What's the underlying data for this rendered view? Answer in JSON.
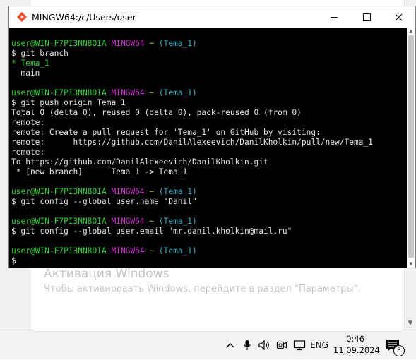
{
  "window": {
    "title": "MINGW64:/c/Users/user"
  },
  "terminal": {
    "prompt": {
      "user_host": "user@WIN-F7PI3NN8OIA",
      "env": "MINGW64",
      "path": "~",
      "branch": "(Tema_1)"
    },
    "lines": {
      "cmd1": "$ git branch",
      "out1a": "* Tema_1",
      "out1b": "  main",
      "cmd2": "$ git push origin Tema_1",
      "out2a": "Total 0 (delta 0), reused 0 (delta 0), pack-reused 0 (from 0)",
      "out2b": "remote:",
      "out2c": "remote: Create a pull request for 'Tema_1' on GitHub by visiting:",
      "out2d": "remote:      https://github.com/DanilAlexeevich/DanilKholkin/pull/new/Tema_1",
      "out2e": "remote:",
      "out2f": "To https://github.com/DanilAlexeevich/DanilKholkin.git",
      "out2g": " * [new branch]      Tema_1 -> Tema_1",
      "cmd3": "$ git config --global user.name \"Danil\"",
      "cmd4": "$ git config --global user.email \"mr.danil.kholkin@mail.ru\"",
      "cmd5": "$"
    }
  },
  "watermark": {
    "title": "Активация Windows",
    "subtitle": "Чтобы активировать Windows, перейдите в раздел \"Параметры\"."
  },
  "taskbar": {
    "language": "ENG",
    "time": "0:46",
    "date": "11.09.2024",
    "notification_count": "8"
  },
  "colors": {
    "prompt_user": "#2fd22f",
    "prompt_env": "#d13bd1",
    "prompt_path": "#c7c42f",
    "prompt_branch": "#3bb0c7"
  }
}
